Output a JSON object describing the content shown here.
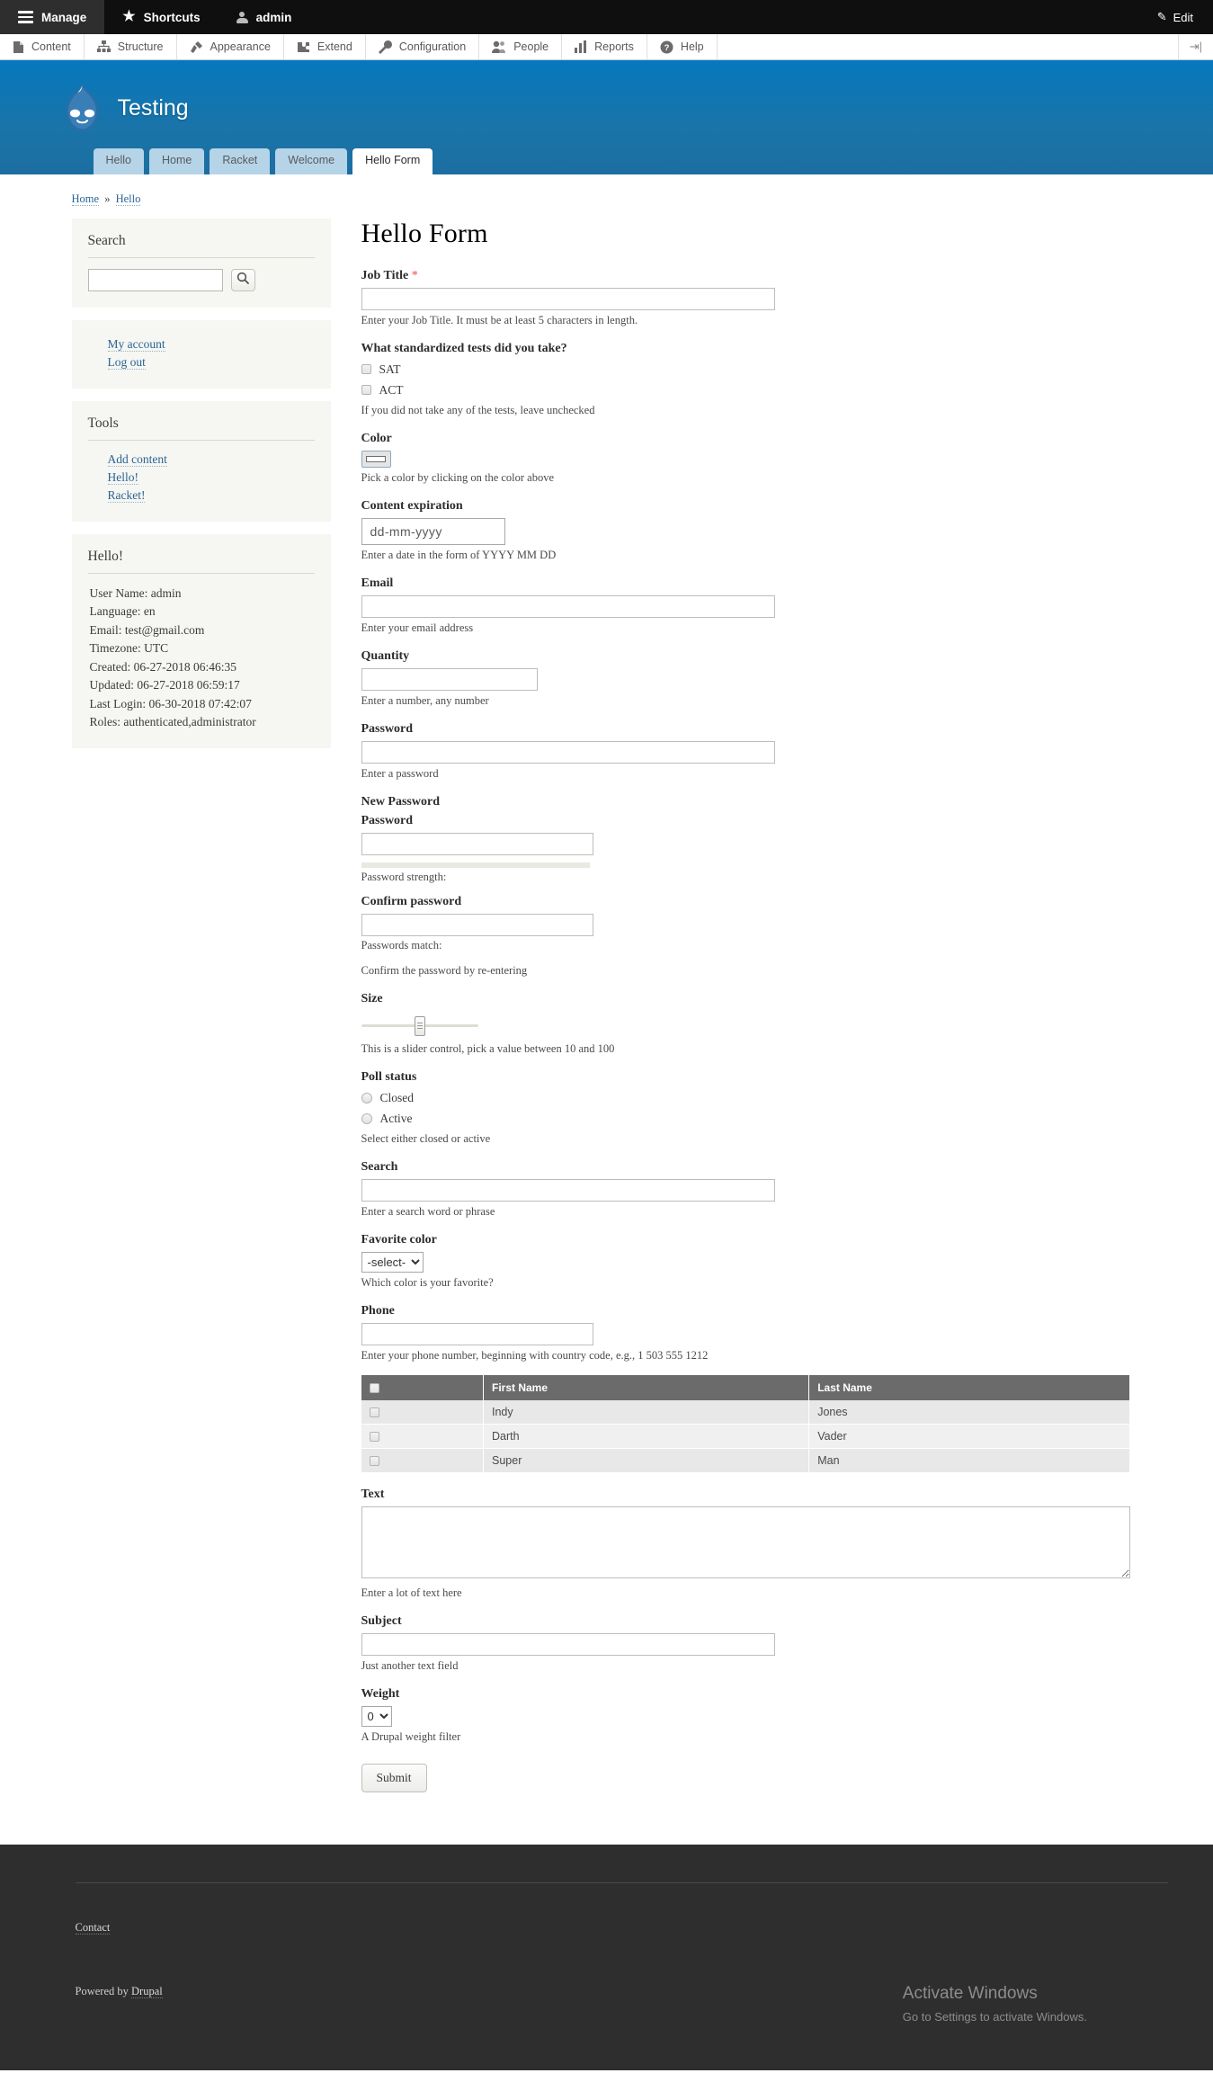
{
  "toolbar": {
    "manage": "Manage",
    "shortcuts": "Shortcuts",
    "user": "admin",
    "edit": "Edit",
    "menu": [
      {
        "label": "Content",
        "icon": "content-icon"
      },
      {
        "label": "Structure",
        "icon": "structure-icon"
      },
      {
        "label": "Appearance",
        "icon": "appearance-icon"
      },
      {
        "label": "Extend",
        "icon": "extend-icon"
      },
      {
        "label": "Configuration",
        "icon": "configuration-icon"
      },
      {
        "label": "People",
        "icon": "people-icon"
      },
      {
        "label": "Reports",
        "icon": "reports-icon"
      },
      {
        "label": "Help",
        "icon": "help-icon"
      }
    ]
  },
  "header": {
    "site_name": "Testing",
    "tabs": [
      {
        "label": "Hello",
        "active": false
      },
      {
        "label": "Home",
        "active": false
      },
      {
        "label": "Racket",
        "active": false
      },
      {
        "label": "Welcome",
        "active": false
      },
      {
        "label": "Hello Form",
        "active": true
      }
    ]
  },
  "breadcrumb": {
    "home": "Home",
    "separator": "»",
    "current": "Hello"
  },
  "sidebar": {
    "search": {
      "title": "Search",
      "value": "",
      "placeholder": ""
    },
    "account_links": [
      {
        "label": "My account"
      },
      {
        "label": "Log out"
      }
    ],
    "tools": {
      "title": "Tools",
      "links": [
        {
          "label": "Add content"
        },
        {
          "label": "Hello!"
        },
        {
          "label": "Racket!"
        }
      ]
    },
    "user_block": {
      "title": "Hello!",
      "lines": [
        "User Name: admin",
        "Language: en",
        "Email: test@gmail.com",
        "Timezone: UTC",
        "Created: 06-27-2018 06:46:35",
        "Updated: 06-27-2018 06:59:17",
        "Last Login: 06-30-2018 07:42:07",
        "Roles: authenticated,administrator"
      ]
    }
  },
  "form": {
    "title": "Hello Form",
    "job_title": {
      "label": "Job Title",
      "required_mark": "*",
      "value": "",
      "description": "Enter your Job Title. It must be at least 5 characters in length."
    },
    "tests": {
      "label": "What standardized tests did you take?",
      "options": [
        {
          "label": "SAT",
          "checked": false
        },
        {
          "label": "ACT",
          "checked": false
        }
      ],
      "description": "If you did not take any of the tests, leave unchecked"
    },
    "color": {
      "label": "Color",
      "value": "#ffffff",
      "description": "Pick a color by clicking on the color above"
    },
    "expiration": {
      "label": "Content expiration",
      "value": "dd-mm-yyyy",
      "description": "Enter a date in the form of YYYY MM DD"
    },
    "email": {
      "label": "Email",
      "value": "",
      "description": "Enter your email address"
    },
    "quantity": {
      "label": "Quantity",
      "value": "",
      "description": "Enter a number, any number"
    },
    "password": {
      "label": "Password",
      "value": "",
      "description": "Enter a password"
    },
    "new_password": {
      "group_label": "New Password",
      "label": "Password",
      "value": "",
      "strength_label": "Password strength:",
      "strength_value": "",
      "confirm_label": "Confirm password",
      "confirm_value": "",
      "match_label": "Passwords match:",
      "description": "Confirm the password by re-entering"
    },
    "size": {
      "label": "Size",
      "value": 45,
      "min": 10,
      "max": 100,
      "description": "This is a slider control, pick a value between 10 and 100"
    },
    "poll_status": {
      "label": "Poll status",
      "options": [
        {
          "label": "Closed",
          "selected": false
        },
        {
          "label": "Active",
          "selected": false
        }
      ],
      "description": "Select either closed or active"
    },
    "search": {
      "label": "Search",
      "value": "",
      "description": "Enter a search word or phrase"
    },
    "favorite_color": {
      "label": "Favorite color",
      "selected": "-select-",
      "options": [
        "-select-"
      ],
      "description": "Which color is your favorite?"
    },
    "phone": {
      "label": "Phone",
      "value": "",
      "description": "Enter your phone number, beginning with country code, e.g., 1 503 555 1212"
    },
    "table": {
      "columns": [
        "",
        "First Name",
        "Last Name"
      ],
      "select_all_checked": false,
      "rows": [
        {
          "checked": false,
          "first": "Indy",
          "last": "Jones"
        },
        {
          "checked": false,
          "first": "Darth",
          "last": "Vader"
        },
        {
          "checked": false,
          "first": "Super",
          "last": "Man"
        }
      ]
    },
    "text": {
      "label": "Text",
      "value": "",
      "description": "Enter a lot of text here"
    },
    "subject": {
      "label": "Subject",
      "value": "",
      "description": "Just another text field"
    },
    "weight": {
      "label": "Weight",
      "selected": "0",
      "options": [
        "0"
      ],
      "description": "A Drupal weight filter"
    },
    "submit": "Submit"
  },
  "footer": {
    "contact": "Contact",
    "powered_prefix": "Powered by ",
    "powered_link": "Drupal"
  },
  "watermark": {
    "title": "Activate Windows",
    "subtitle": "Go to Settings to activate Windows."
  }
}
